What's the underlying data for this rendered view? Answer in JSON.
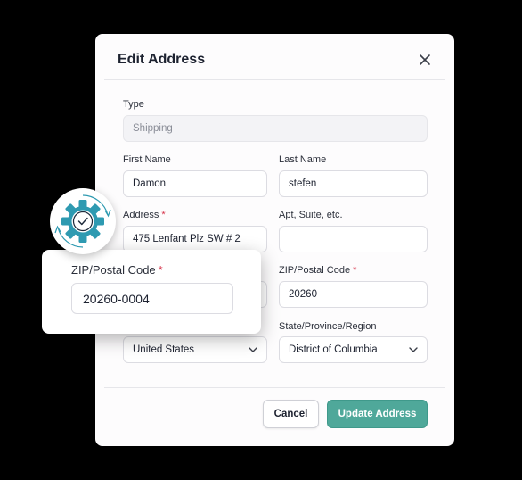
{
  "dialog": {
    "title": "Edit Address",
    "type_label": "Type",
    "type_value": "Shipping",
    "first_name_label": "First Name",
    "first_name_value": "Damon",
    "last_name_label": "Last Name",
    "last_name_value": "stefen",
    "address_label": "Address",
    "address_value": "475 Lenfant Plz SW # 2",
    "apt_label": "Apt, Suite, etc.",
    "apt_value": "",
    "zip_label": "ZIP/Postal Code",
    "zip_value": "20260",
    "state_label": "State/Province/Region",
    "state_value": "District of Columbia",
    "country_value": "United States",
    "required_mark": "*",
    "cancel_label": "Cancel",
    "submit_label": "Update Address"
  },
  "popout": {
    "zip_label": "ZIP/Postal Code",
    "zip_value": "20260-0004",
    "required_mark": "*"
  },
  "colors": {
    "accent": "#4fa89a",
    "gear": "#2e9ab1",
    "required": "#d6334a"
  },
  "icons": [
    "close-icon",
    "gear-check-icon",
    "chevron-down-icon"
  ]
}
